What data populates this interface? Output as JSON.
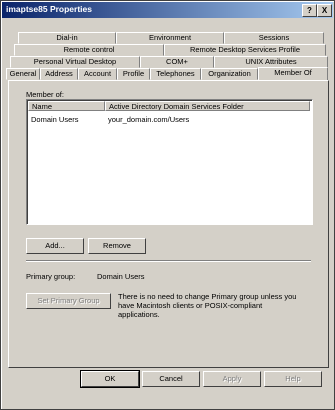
{
  "window": {
    "title": "imaptse85 Properties",
    "help_glyph": "?",
    "close_glyph": "X"
  },
  "tabs": {
    "row1": [
      "Dial-in",
      "Environment",
      "Sessions"
    ],
    "row2": [
      "Remote control",
      "Remote Desktop Services Profile"
    ],
    "row3": [
      "Personal Virtual Desktop",
      "COM+",
      "UNIX Attributes"
    ],
    "row4": [
      "General",
      "Address",
      "Account",
      "Profile",
      "Telephones",
      "Organization",
      "Member Of"
    ],
    "active": "Member Of"
  },
  "member_of": {
    "label": "Member of:",
    "columns": [
      "Name",
      "Active Directory Domain Services Folder"
    ],
    "rows": [
      {
        "name": "Domain Users",
        "folder": "your_domain.com/Users"
      }
    ]
  },
  "buttons": {
    "add": "Add...",
    "remove": "Remove",
    "set_primary": "Set Primary Group",
    "ok": "OK",
    "cancel": "Cancel",
    "apply": "Apply",
    "help": "Help"
  },
  "primary_group": {
    "label": "Primary group:",
    "value": "Domain Users",
    "note": "There is no need to change Primary group unless you have Macintosh clients or POSIX-compliant applications."
  }
}
